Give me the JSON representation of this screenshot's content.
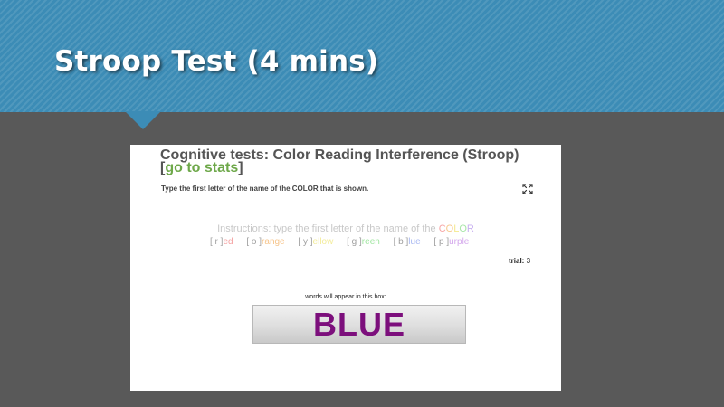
{
  "slide": {
    "title": "Stroop Test (4 mins)",
    "banner_color": "#3c8cb6",
    "background_color": "#595959"
  },
  "app": {
    "title_prefix": "Cognitive tests: Color Reading Interference (Stroop) [",
    "stats_link": "go to stats",
    "title_suffix": "]",
    "task_instruction": "Type the first letter of the name of the COLOR that is shown.",
    "expand_icon": "expand-arrows-icon",
    "instructions_prefix": "Instructions: type the first letter of the name of the ",
    "instructions_color_word": [
      "C",
      "O",
      "L",
      "O",
      "R"
    ],
    "instructions_color_word_colors": [
      "#f7a6a6",
      "#f7c98e",
      "#f4ea8f",
      "#a8e6a8",
      "#c8b0f0"
    ],
    "legend": [
      {
        "key": "[ r ]",
        "rest": "ed",
        "color": "#f4a0a0"
      },
      {
        "key": "[ o ]",
        "rest": "range",
        "color": "#f6c48a"
      },
      {
        "key": "[ y ]",
        "rest": "ellow",
        "color": "#f3ec9a"
      },
      {
        "key": "[ g ]",
        "rest": "reen",
        "color": "#a0e6a0"
      },
      {
        "key": "[ b ]",
        "rest": "lue",
        "color": "#a8b8f2"
      },
      {
        "key": "[ p ]",
        "rest": "urple",
        "color": "#d4a8ec"
      }
    ],
    "trial_label": "trial:",
    "trial_value": "3",
    "box_caption": "words will appear in this box:",
    "stimulus_word": "BLUE",
    "stimulus_color": "#7c0f7c"
  }
}
